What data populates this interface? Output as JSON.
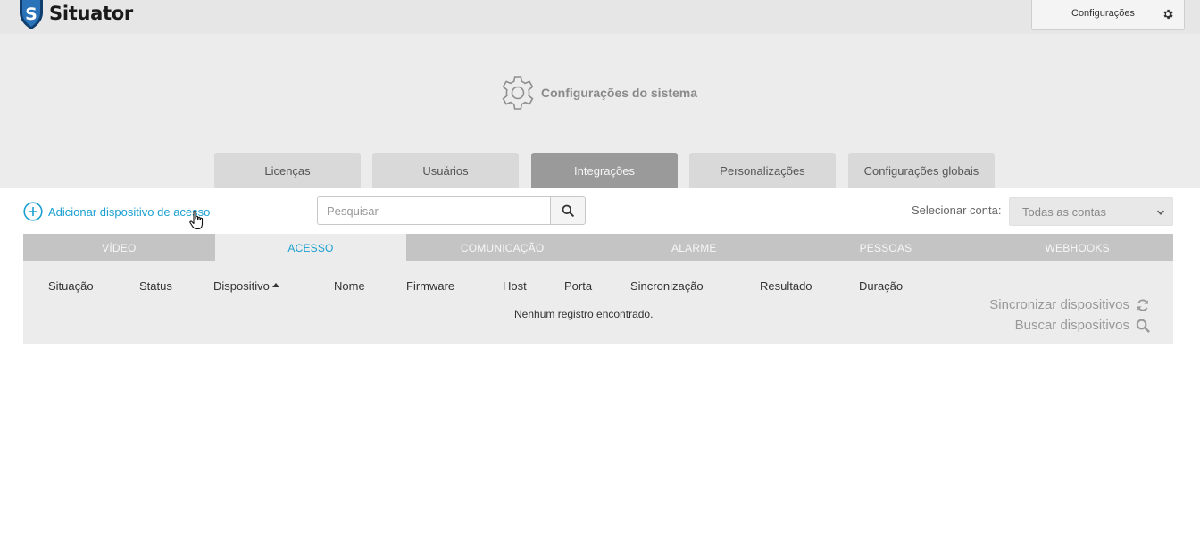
{
  "header": {
    "logo_text": "Situator",
    "logo_letter": "S",
    "config_label": "Configurações"
  },
  "hero": {
    "title": "Configurações do sistema"
  },
  "tabs": [
    {
      "label": "Licenças",
      "active": false
    },
    {
      "label": "Usuários",
      "active": false
    },
    {
      "label": "Integrações",
      "active": true
    },
    {
      "label": "Personalizações",
      "active": false
    },
    {
      "label": "Configurações globais",
      "active": false
    }
  ],
  "toolbar": {
    "add_label": "Adicionar dispositivo de acesso",
    "search_placeholder": "Pesquisar",
    "search_value": "",
    "account_label": "Selecionar conta:",
    "account_selected": "Todas as contas"
  },
  "subtabs": [
    {
      "label": "VÍDEO",
      "active": false
    },
    {
      "label": "ACESSO",
      "active": true
    },
    {
      "label": "COMUNICAÇÃO",
      "active": false
    },
    {
      "label": "ALARME",
      "active": false
    },
    {
      "label": "PESSOAS",
      "active": false
    },
    {
      "label": "WEBHOOKS",
      "active": false
    }
  ],
  "table": {
    "columns": [
      "Situação",
      "Status",
      "Dispositivo",
      "Nome",
      "Firmware",
      "Host",
      "Porta",
      "Sincronização",
      "Resultado",
      "Duração"
    ],
    "sorted_column": "Dispositivo",
    "sort_direction": "asc",
    "empty_message": "Nenhum registro encontrado.",
    "sync_label": "Sincronizar dispositivos",
    "find_label": "Buscar dispositivos"
  },
  "colors": {
    "accent": "#1ba0d1",
    "active_tab": "#9a9a9a",
    "logo_blue": "#1e5fa8"
  },
  "icons": {
    "logo": "shield-s-icon",
    "config": "gear-icon",
    "hero": "gear-outline-icon",
    "add": "plus-circle-icon",
    "search": "search-icon",
    "sync": "refresh-icon",
    "find": "search-icon",
    "cursor": "hand-pointer-icon"
  }
}
